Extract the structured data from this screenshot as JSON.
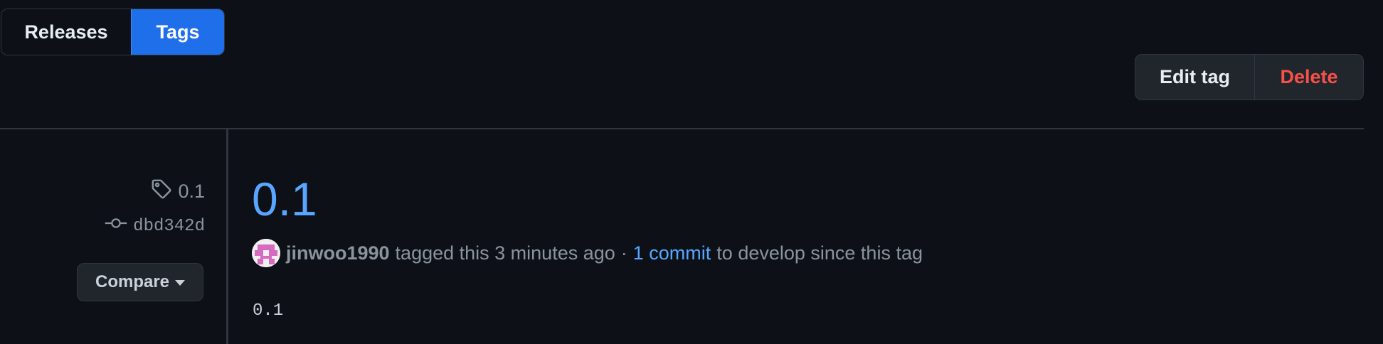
{
  "tabs": {
    "releases_label": "Releases",
    "tags_label": "Tags",
    "active": "Tags"
  },
  "actions": {
    "edit_label": "Edit tag",
    "delete_label": "Delete"
  },
  "sidebar": {
    "tag_name": "0.1",
    "commit_sha": "dbd342d",
    "compare_label": "Compare"
  },
  "release": {
    "title": "0.1",
    "author": "jinwoo1990",
    "tagged_text": "tagged this 3 minutes ago",
    "separator": "·",
    "commits_link": "1 commit",
    "since_text": "to develop since this tag",
    "body": "0.1"
  },
  "colors": {
    "background": "#0d1117",
    "accent_blue": "#1f6feb",
    "link_blue": "#58a6ff",
    "danger_red": "#f85149",
    "border": "#30363d"
  },
  "icons": {
    "tag": "tag-icon",
    "commit": "git-commit-icon",
    "compare_caret": "caret-down-icon",
    "avatar": "identicon-avatar"
  }
}
